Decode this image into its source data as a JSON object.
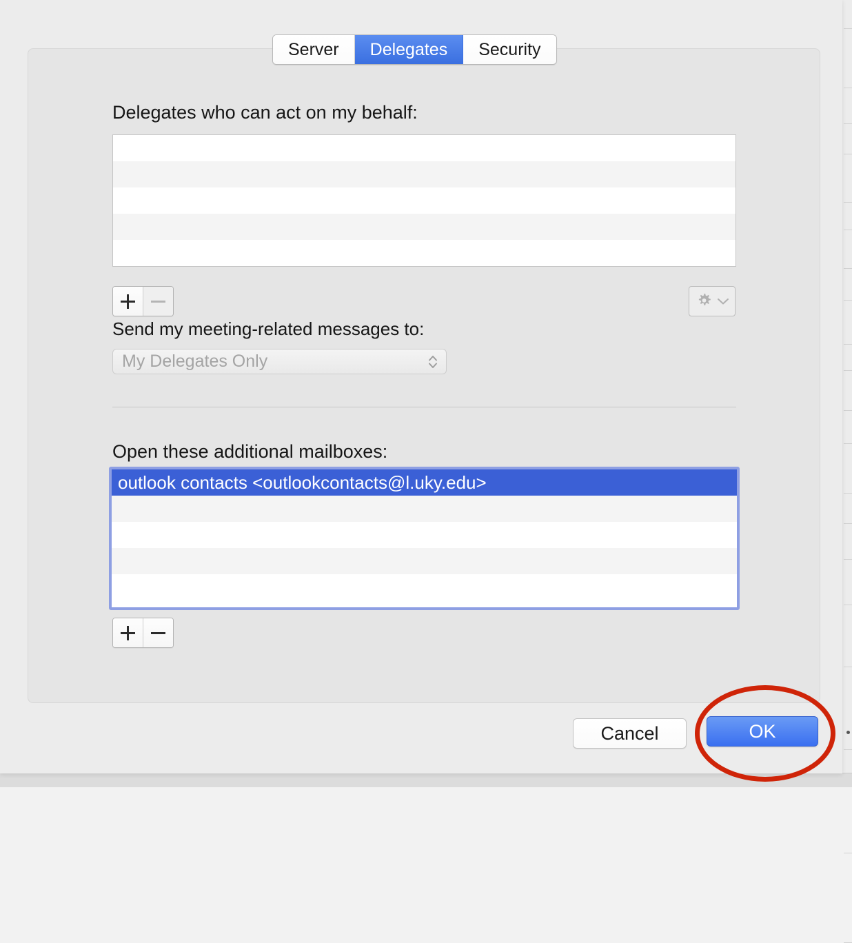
{
  "dialog": {
    "tabs": [
      {
        "label": "Server",
        "selected": false
      },
      {
        "label": "Delegates",
        "selected": true
      },
      {
        "label": "Security",
        "selected": false
      }
    ],
    "delegates_section": {
      "label": "Delegates who can act on my behalf:",
      "items": [],
      "row_count": 5,
      "add_button": "+",
      "remove_button": "—",
      "remove_enabled": false,
      "gear_icon": "gear-icon",
      "gear_chevron_icon": "chevron-down-icon",
      "gear_enabled": false
    },
    "send_to_section": {
      "label": "Send my meeting-related messages to:",
      "selected_value": "My Delegates Only",
      "enabled": false,
      "stepper_icon": "up-down-chevron-icon"
    },
    "mailboxes_section": {
      "label": "Open these additional mailboxes:",
      "items": [
        {
          "text": "outlook contacts <outlookcontacts@l.uky.edu>",
          "selected": true
        }
      ],
      "row_count": 5,
      "add_button": "+",
      "remove_button": "—",
      "remove_enabled": true,
      "focused": true
    },
    "footer": {
      "cancel_label": "Cancel",
      "ok_label": "OK"
    }
  },
  "annotation": {
    "shape": "ellipse",
    "color": "#cf2408",
    "target": "OK"
  },
  "colors": {
    "accent_blue": "#3b60d6",
    "tab_selected": "#4a7ee8",
    "ok_button": "#3a6ff0",
    "focus_ring": "#8e9fe3",
    "annotation_red": "#cf2408",
    "dialog_background": "#ececec",
    "panel_background": "#e5e5e5",
    "row_stripe": "#f4f4f4"
  }
}
